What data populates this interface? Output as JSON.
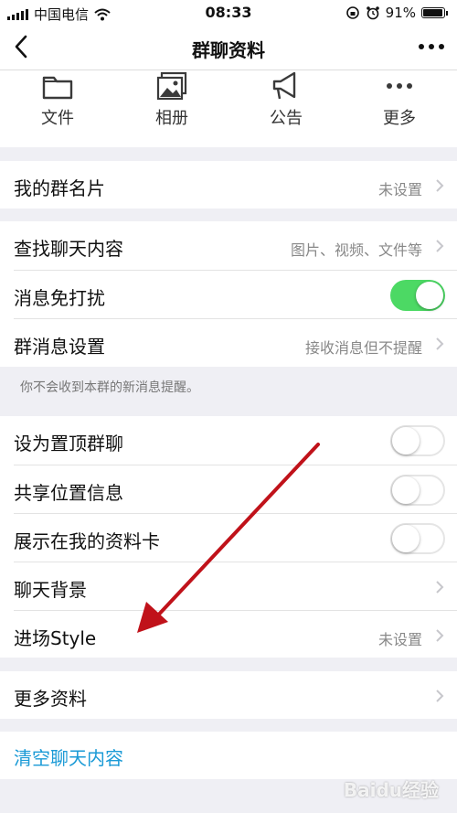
{
  "status": {
    "carrier": "中国电信",
    "time": "08:33",
    "battery": "91%"
  },
  "nav": {
    "title": "群聊资料"
  },
  "quick": [
    {
      "label": "文件",
      "icon": "folder-icon"
    },
    {
      "label": "相册",
      "icon": "photo-album-icon"
    },
    {
      "label": "公告",
      "icon": "megaphone-icon"
    },
    {
      "label": "更多",
      "icon": "more-dots-icon"
    }
  ],
  "rows": {
    "nickname": {
      "label": "我的群名片",
      "value": "未设置"
    },
    "search": {
      "label": "查找聊天内容",
      "value": "图片、视频、文件等"
    },
    "mute": {
      "label": "消息免打扰",
      "on": true
    },
    "msgsetting": {
      "label": "群消息设置",
      "value": "接收消息但不提醒"
    },
    "note": "你不会收到本群的新消息提醒。",
    "pin": {
      "label": "设为置顶群聊",
      "on": false
    },
    "location": {
      "label": "共享位置信息",
      "on": false
    },
    "profilecard": {
      "label": "展示在我的资料卡",
      "on": false
    },
    "background": {
      "label": "聊天背景"
    },
    "entrance": {
      "label": "进场Style",
      "value": "未设置"
    },
    "moreinfo": {
      "label": "更多资料"
    },
    "clear": {
      "label": "清空聊天内容"
    }
  },
  "colors": {
    "toggle_on": "#4cd964",
    "link": "#1a9ad6",
    "arrow": "#c0121a"
  },
  "watermark": "Baidu经验"
}
